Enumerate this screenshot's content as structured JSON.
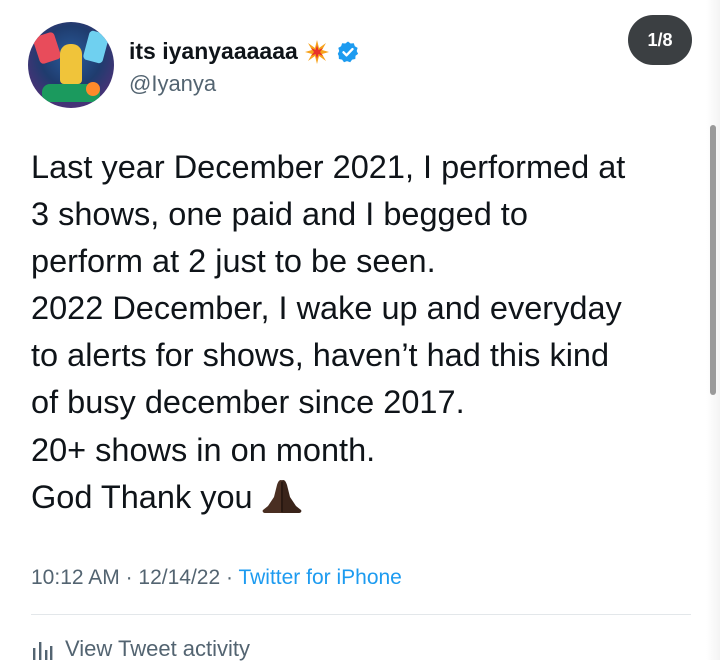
{
  "author": {
    "display_name": "its iyanyaaaaaa",
    "handle": "@Iyanya",
    "verified": true,
    "name_emoji": "collision-burst-icon"
  },
  "pager": {
    "label": "1/8"
  },
  "tweet": {
    "lines": [
      "Last year December 2021, I performed at",
      "3 shows, one paid and I begged to",
      "perform at 2 just to be seen.",
      "2022 December, I wake up and everyday",
      "to alerts for shows, haven’t had this kind",
      "of busy december since 2017.",
      "20+ shows in on month.",
      "God Thank you"
    ],
    "trailing_emoji": "folded-hands-icon"
  },
  "meta": {
    "time": "10:12 AM",
    "separator": " · ",
    "date": "12/14/22",
    "source": "Twitter for iPhone"
  },
  "activity": {
    "label": "View Tweet activity"
  },
  "colors": {
    "text": "#0f1419",
    "secondary": "#536471",
    "link": "#1d9bf0",
    "badge_bg": "#3b3f42",
    "verified": "#1d9bf0"
  }
}
